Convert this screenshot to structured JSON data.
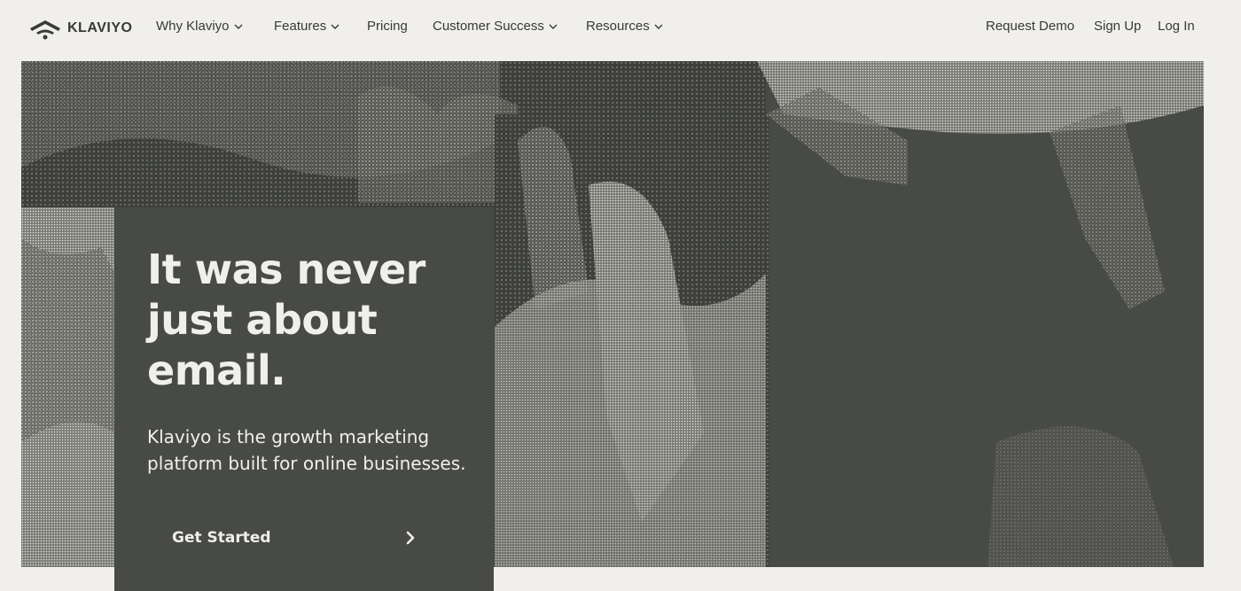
{
  "brand": {
    "name": "KLAVIYO"
  },
  "nav": {
    "items": [
      {
        "label": "Why Klaviyo",
        "dropdown": true
      },
      {
        "label": "Features",
        "dropdown": true
      },
      {
        "label": "Pricing",
        "dropdown": false
      },
      {
        "label": "Customer Success",
        "dropdown": true
      },
      {
        "label": "Resources",
        "dropdown": true
      }
    ],
    "right": {
      "request_demo": "Request Demo",
      "sign_up": "Sign Up",
      "log_in": "Log In"
    }
  },
  "hero": {
    "headline": "It was never just about email.",
    "subheading": "Klaviyo is the growth marketing platform built for online businesses.",
    "cta_label": "Get Started"
  },
  "colors": {
    "background": "#f0efec",
    "hero_dark": "#484a45",
    "text": "#373a36"
  }
}
